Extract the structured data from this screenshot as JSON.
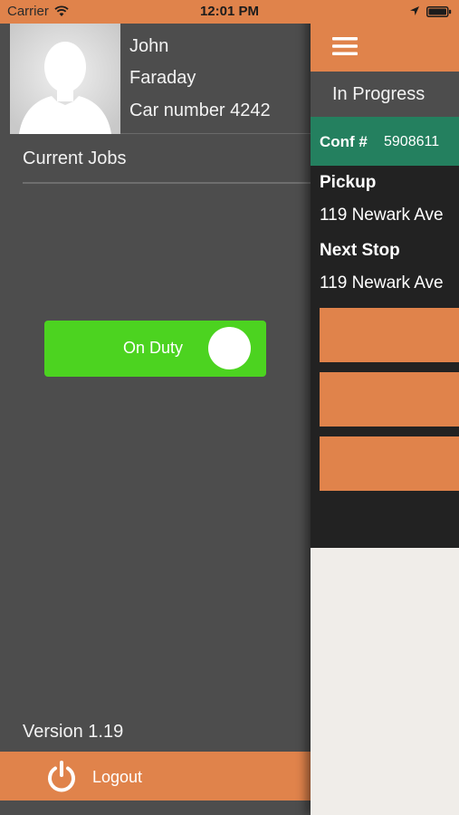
{
  "status_bar": {
    "carrier": "Carrier",
    "time": "12:01 PM",
    "icons": [
      "wifi-icon",
      "location-icon",
      "battery-icon"
    ]
  },
  "profile": {
    "first_name": "John",
    "last_name": "Faraday",
    "car_number": "Car number 4242",
    "avatar_icon": "person-silhouette-icon"
  },
  "menu": {
    "current_jobs_label": "Current Jobs",
    "duty_toggle": {
      "label": "On Duty",
      "state": "on"
    },
    "version": "Version 1.19",
    "logout_label": "Logout",
    "logout_icon": "power-icon"
  },
  "main": {
    "menu_icon": "hamburger-icon",
    "tab_label": "In Progress",
    "job": {
      "conf_label": "Conf #",
      "conf_number": "5908611",
      "pickup_heading": "Pickup",
      "pickup_address": "119 Newark Ave",
      "next_stop_heading": "Next Stop",
      "next_stop_address": "119 Newark Ave"
    }
  },
  "colors": {
    "accent_orange": "#e0834b",
    "menu_background": "#4d4d4d",
    "duty_green": "#4cd320",
    "conf_green": "#24805f",
    "card_dark": "#222222"
  }
}
